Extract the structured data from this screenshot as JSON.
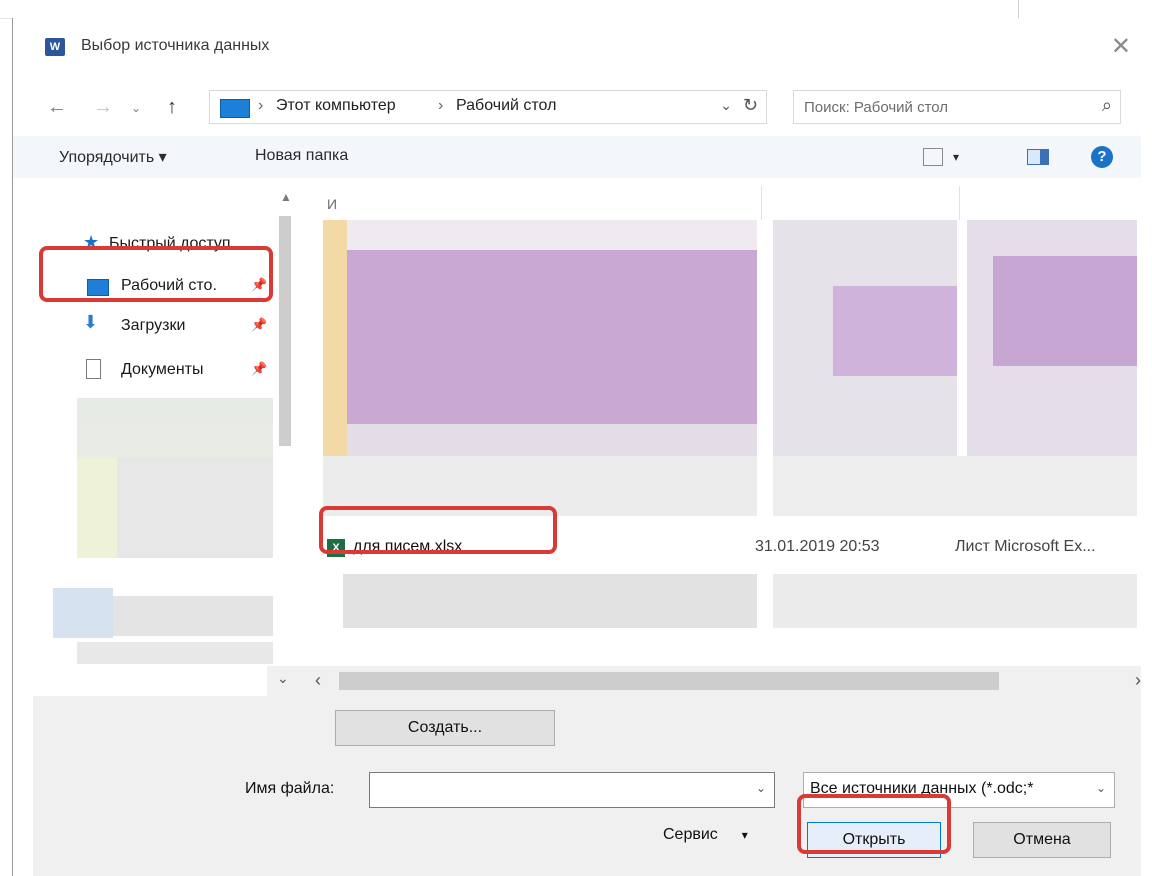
{
  "window": {
    "title": "Выбор источника данных"
  },
  "address": {
    "crumbs": [
      "Этот компьютер",
      "Рабочий стол"
    ]
  },
  "search": {
    "placeholder": "Поиск: Рабочий стол"
  },
  "toolbar": {
    "organize": "Упорядочить",
    "new_folder": "Новая папка"
  },
  "navigation": {
    "items": [
      {
        "label": "Быстрый доступ"
      },
      {
        "label": "Рабочий сто."
      },
      {
        "label": "Загрузки"
      },
      {
        "label": "Документы"
      }
    ]
  },
  "files": {
    "visible_row": {
      "name": "для писем.xlsx",
      "date": "31.01.2019 20:53",
      "type": "Лист Microsoft Ex..."
    }
  },
  "buttons": {
    "create": "Создать...",
    "open": "Открыть",
    "cancel": "Отмена",
    "service": "Сервис"
  },
  "filename": {
    "label": "Имя файла:",
    "value": ""
  },
  "filetype": {
    "selected": "Все источники данных (*.odc;*"
  },
  "colors": {
    "highlight": "#d93a35",
    "accent": "#1a73c9"
  }
}
